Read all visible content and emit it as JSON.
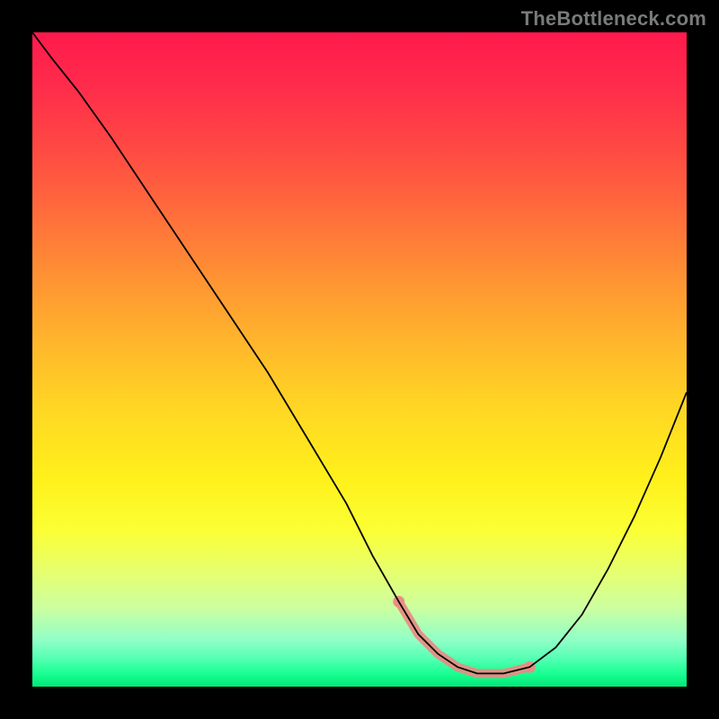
{
  "watermark": "TheBottleneck.com",
  "chart_data": {
    "type": "line",
    "title": "",
    "xlabel": "",
    "ylabel": "",
    "xlim": [
      0,
      100
    ],
    "ylim": [
      0,
      100
    ],
    "series": [
      {
        "name": "bottleneck-curve",
        "x": [
          0,
          3,
          7,
          12,
          18,
          24,
          30,
          36,
          42,
          48,
          52,
          56,
          59,
          62,
          65,
          68,
          72,
          76,
          80,
          84,
          88,
          92,
          96,
          100
        ],
        "y": [
          100,
          96,
          91,
          84,
          75,
          66,
          57,
          48,
          38,
          28,
          20,
          13,
          8,
          5,
          3,
          2,
          2,
          3,
          6,
          11,
          18,
          26,
          35,
          45
        ]
      }
    ],
    "highlight": {
      "name": "optimal-range",
      "x": [
        56,
        59,
        62,
        65,
        68,
        72,
        76
      ],
      "y": [
        13,
        8,
        5,
        3,
        2,
        2,
        3
      ]
    }
  }
}
